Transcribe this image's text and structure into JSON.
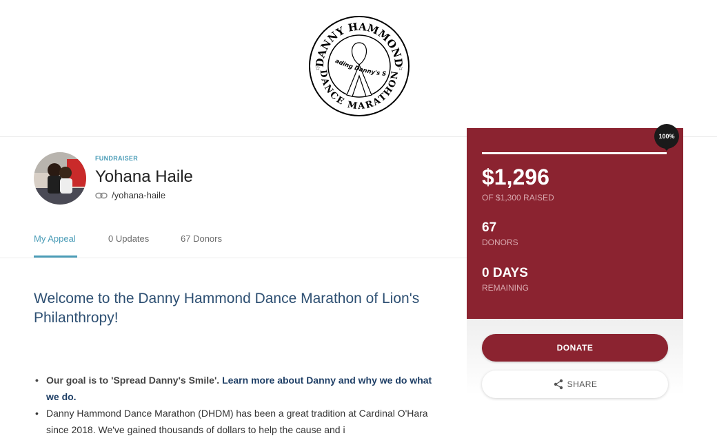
{
  "logo": {
    "top_text": "DANNY HAMMOND",
    "middle_text": "Spreading Danny's Smile",
    "bottom_text": "DANCE MARATHON"
  },
  "profile": {
    "role": "FUNDRAISER",
    "name": "Yohana Haile",
    "slug": "/yohana-haile"
  },
  "tabs": [
    {
      "label": "My Appeal"
    },
    {
      "label": "0 Updates"
    },
    {
      "label": "67 Donors"
    }
  ],
  "content": {
    "welcome": "Welcome to the Danny Hammond Dance Marathon of Lion's Philanthropy!",
    "bullets": [
      {
        "text": "Our goal is to 'Spread Danny's Smile'. ",
        "link": "Learn more about Danny and why we do what we do."
      },
      {
        "text": "Danny Hammond Dance Marathon (DHDM) has been a great tradition at Cardinal O'Hara since 2018. We've gained thousands of dollars to help the cause and i"
      }
    ]
  },
  "stats": {
    "progress_badge": "100%",
    "progress_fraction": 1.0,
    "raised": "$1,296",
    "raised_sub": "OF $1,300 RAISED",
    "donors_value": "67",
    "donors_label": "DONORS",
    "days_value": "0 DAYS",
    "days_label": "REMAINING"
  },
  "actions": {
    "donate": "DONATE",
    "share": "SHARE"
  },
  "colors": {
    "brand": "#8b2330",
    "accent": "#4a9cb7",
    "heading": "#2d4f72"
  }
}
